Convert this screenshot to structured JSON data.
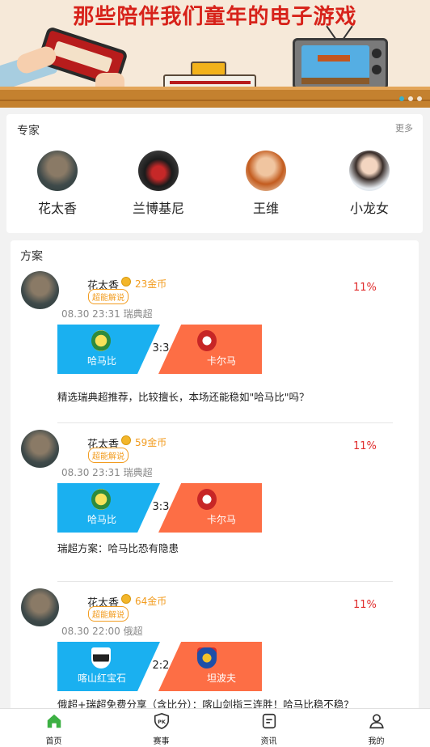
{
  "banner": {
    "title": "那些陪伴我们童年的电子游戏",
    "carousel_dots": 3,
    "active_dot": 1
  },
  "experts": {
    "title": "专家",
    "more": "更多",
    "items": [
      {
        "name": "花太香",
        "avatar": "avatar-dark"
      },
      {
        "name": "兰博基尼",
        "avatar": "avatar-car"
      },
      {
        "name": "王维",
        "avatar": "avatar-man"
      },
      {
        "name": "小龙女",
        "avatar": "avatar-woman"
      }
    ]
  },
  "plans": {
    "title": "方案",
    "items": [
      {
        "author": "花太香",
        "price": "23金币",
        "tag": "超能解说",
        "rate": "11%",
        "meta": "08.30 23:31 瑞典超",
        "home": "哈马比",
        "away": "卡尔马",
        "score": "3:3",
        "desc": "精选瑞典超推荐，比较擅长，本场还能稳如\"哈马比\"吗？"
      },
      {
        "author": "花太香",
        "price": "59金币",
        "tag": "超能解说",
        "rate": "11%",
        "meta": "08.30 23:31 瑞典超",
        "home": "哈马比",
        "away": "卡尔马",
        "score": "3:3",
        "desc": "瑞超方案：哈马比恐有隐患"
      },
      {
        "author": "花太香",
        "price": "64金币",
        "tag": "超能解说",
        "rate": "11%",
        "meta": "08.30 22:00 俄超",
        "home": "喀山红宝石",
        "away": "坦波夫",
        "score": "2:2",
        "desc": "俄超+瑞超免费分享（含比分）：喀山剑指三连胜！哈马比稳不稳？"
      }
    ]
  },
  "tabbar": {
    "items": [
      {
        "label": "首页",
        "icon": "home-icon",
        "active": true,
        "color": "#3cb043"
      },
      {
        "label": "赛事",
        "icon": "shield-icon",
        "active": false
      },
      {
        "label": "资讯",
        "icon": "news-icon",
        "active": false
      },
      {
        "label": "我的",
        "icon": "user-icon",
        "active": false
      }
    ]
  },
  "colors": {
    "home_team": "#1ab0f0",
    "away_team": "#fd6e45",
    "rate": "#e02b2b",
    "price": "#f29c1f",
    "active_tab": "#3cb043"
  }
}
